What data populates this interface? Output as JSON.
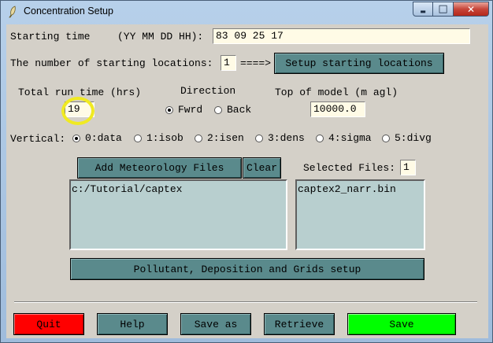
{
  "window": {
    "title": "Concentration Setup",
    "minimize_glyph": "▬",
    "maximize_glyph": "□",
    "close_glyph": "✕"
  },
  "start_time": {
    "label": "Starting time",
    "format": "(YY MM DD HH):",
    "value": "83 09 25 17"
  },
  "locations": {
    "label": "The number of starting locations:",
    "value": "1",
    "arrow": "====>",
    "button": "Setup starting locations"
  },
  "run_time": {
    "label": "Total run time (hrs)",
    "value": "19"
  },
  "direction": {
    "label": "Direction",
    "options": [
      "Fwrd",
      "Back"
    ],
    "selected": "Fwrd"
  },
  "top_model": {
    "label": "Top of model (m agl)",
    "value": "10000.0"
  },
  "vertical": {
    "label": "Vertical:",
    "options": [
      "0:data",
      "1:isob",
      "2:isen",
      "3:dens",
      "4:sigma",
      "5:divg"
    ],
    "selected": "0:data"
  },
  "met_files": {
    "add_button": "Add Meteorology Files",
    "clear_button": "Clear",
    "selected_label": "Selected Files:",
    "selected_count": "1",
    "directory_list": [
      "c:/Tutorial/captex"
    ],
    "file_list": [
      "captex2_narr.bin"
    ]
  },
  "pollutant_button": "Pollutant, Deposition and Grids setup",
  "bottom_buttons": {
    "quit": "Quit",
    "help": "Help",
    "save_as": "Save as",
    "retrieve": "Retrieve",
    "save": "Save"
  },
  "colors": {
    "button_teal": "#5a8a8c",
    "quit_red": "#ff0000",
    "save_green": "#00ff00",
    "entry_bg": "#fffbe6",
    "highlight_yellow": "#f0ea22"
  }
}
